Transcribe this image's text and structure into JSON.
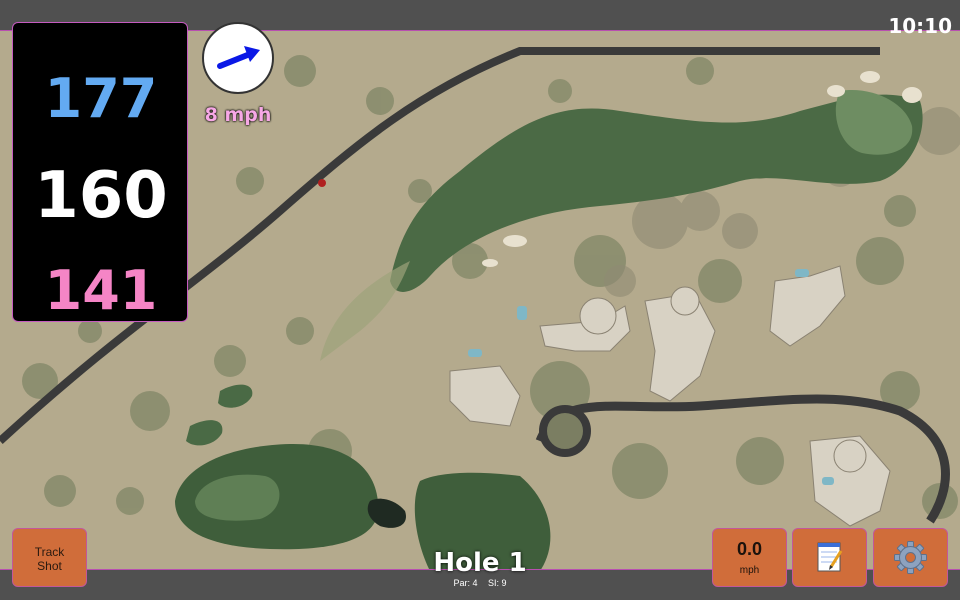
{
  "status": {
    "time": "10:10"
  },
  "distances": {
    "back": "177",
    "center": "160",
    "front": "141"
  },
  "wind": {
    "speed_label": "8 mph",
    "direction_icon": "arrow-icon",
    "arrow_color": "#0a18e6"
  },
  "buttons": {
    "track_shot_line1": "Track",
    "track_shot_line2": "Shot",
    "speed_value": "0.0",
    "speed_unit": "mph",
    "notes_icon": "notepad-icon",
    "settings_icon": "gear-icon"
  },
  "hole": {
    "title": "Hole 1",
    "par_label": "Par: 4",
    "si_label": "SI: 9"
  },
  "colors": {
    "back_distance": "#63aaf2",
    "center_distance": "#ffffff",
    "front_distance": "#f585c6",
    "button": "#d06d3a",
    "border_accent": "#c55bc0"
  }
}
